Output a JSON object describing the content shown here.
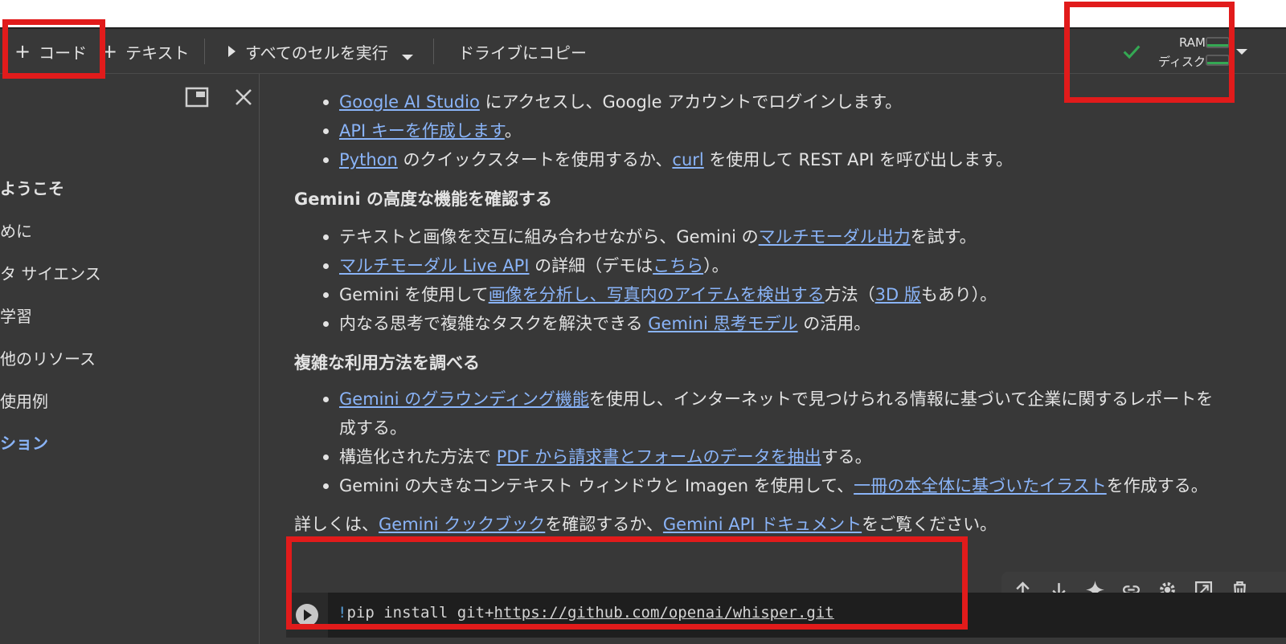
{
  "toolbar": {
    "add_code": "コード",
    "add_text": "テキスト",
    "run_all": "すべてのセルを実行",
    "copy_drive": "ドライブにコピー"
  },
  "status": {
    "ram": "RAM",
    "disk": "ディスク"
  },
  "sidebar": {
    "items": [
      {
        "label": "ようこそ",
        "style": "bold"
      },
      {
        "label": "めに",
        "style": "normal"
      },
      {
        "label": "タ サイエンス",
        "style": "normal"
      },
      {
        "label": "学習",
        "style": "normal"
      },
      {
        "label": "他のリソース",
        "style": "normal"
      },
      {
        "label": "使用例",
        "style": "normal"
      },
      {
        "label": "ション",
        "style": "active"
      }
    ]
  },
  "content": {
    "list1": [
      {
        "link": "Google AI Studio",
        "rest": " にアクセスし、Google アカウントでログインします。"
      },
      {
        "link": "API キーを作成します",
        "rest": "。"
      },
      {
        "link": "Python",
        "mid": " のクイックスタートを使用するか、",
        "link2": "curl",
        "rest": " を使用して REST API を呼び出します。"
      }
    ],
    "heading1": "Gemini の高度な機能を確認する",
    "list2": [
      {
        "pre": "テキストと画像を交互に組み合わせながら、Gemini の",
        "link": "マルチモーダル出力",
        "rest": "を試す。"
      },
      {
        "link": "マルチモーダル Live API",
        "mid": " の詳細（デモは",
        "link2": "こちら",
        "rest": "）。"
      },
      {
        "pre": "Gemini を使用して",
        "link": "画像を分析し、写真内のアイテムを検出する",
        "mid": "方法（",
        "link2": "3D 版",
        "rest": "もあり）。"
      },
      {
        "pre": "内なる思考で複雑なタスクを解決できる ",
        "link": "Gemini 思考モデル",
        "rest": " の活用。"
      }
    ],
    "heading2": "複雑な利用方法を調べる",
    "list3": [
      {
        "link": "Gemini のグラウンディング機能",
        "rest": "を使用し、インターネットで見つけられる情報に基づいて企業に関するレポートを"
      },
      {
        "rest": "成する。"
      },
      {
        "pre": "構造化された方法で ",
        "link": "PDF から請求書とフォームのデータを抽出",
        "rest": "する。"
      },
      {
        "pre": "Gemini の大きなコンテキスト ウィンドウと Imagen を使用して、",
        "link": "一冊の本全体に基づいたイラスト",
        "rest": "を作成する。"
      }
    ],
    "footer": {
      "pre": "詳しくは、",
      "link": "Gemini クックブック",
      "mid": "を確認するか、",
      "link2": "Gemini API ドキュメント",
      "rest": "をご覧ください。"
    }
  },
  "cell": {
    "bang": "!",
    "code": "pip install git+",
    "url": "https://github.com/openai/whisper.git"
  },
  "colors": {
    "background": "#383838",
    "link": "#8ab4f8",
    "annotation": "#e11b1b",
    "check": "#34a853"
  }
}
